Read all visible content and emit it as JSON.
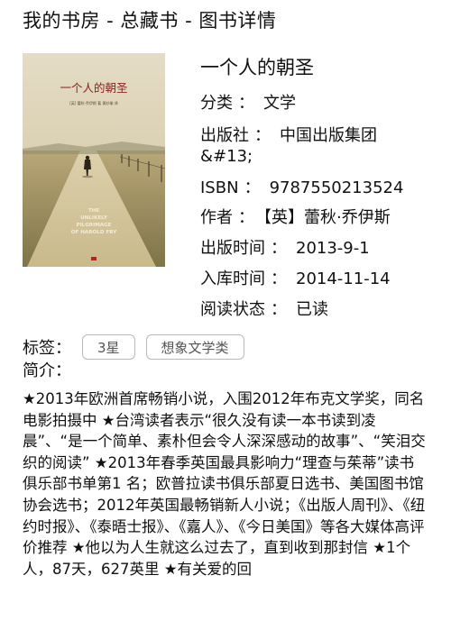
{
  "header": {
    "title": "我的书房 - 总藏书 - 图书详情"
  },
  "book": {
    "cover": {
      "title_cn": "一个人的朝圣",
      "author_line": "[英] 蕾秋·乔伊斯 著 黄妙瑜 译",
      "title_en": [
        "THE",
        "UNLIKELY",
        "PILGRIMAGE",
        "OF HAROLD FRY"
      ]
    },
    "title": "一个人的朝圣",
    "meta": [
      {
        "label": "分类",
        "value": "文学"
      },
      {
        "label": "出版社",
        "value": "中国出版集团"
      },
      {
        "label": "",
        "value": "&#13;"
      },
      {
        "label": "ISBN",
        "value": "9787550213524"
      },
      {
        "label": "作者",
        "value": "【英】蕾秋·乔伊斯"
      },
      {
        "label": "出版时间",
        "value": "2013-9-1"
      },
      {
        "label": "入库时间",
        "value": "2014-11-14"
      },
      {
        "label": "阅读状态",
        "value": "已读"
      }
    ],
    "tags_label": "标签：",
    "tags": [
      "3星",
      "想象文学类"
    ],
    "summary_label": "简介：",
    "summary": "★2013年欧洲首席畅销小说，入围2012年布克文学奖，同名电影拍摄中 ★台湾读者表示“很久没有读一本书读到凌晨”、“是一个简单、素朴但会令人深深感动的故事”、“笑泪交织的阅读” ★2013年春季英国最具影响力“理查与茱蒂”读书俱乐部书单第1 名；欧普拉读书俱乐部夏日选书、美国图书馆协会选书；2012年英国最畅销新人小说；《出版人周刊》、《纽约时报》、《泰晤士报》、《嘉人》、《今日美国》等各大媒体高评价推荐 ★他以为人生就这么过去了，直到收到那封信 ★1个人，87天，627英里 ★有关爱的回"
  },
  "colors": {
    "tag_border": "#b9b9b9",
    "cover_sky": "#d8cfb1",
    "cover_field": "#a79b72"
  }
}
